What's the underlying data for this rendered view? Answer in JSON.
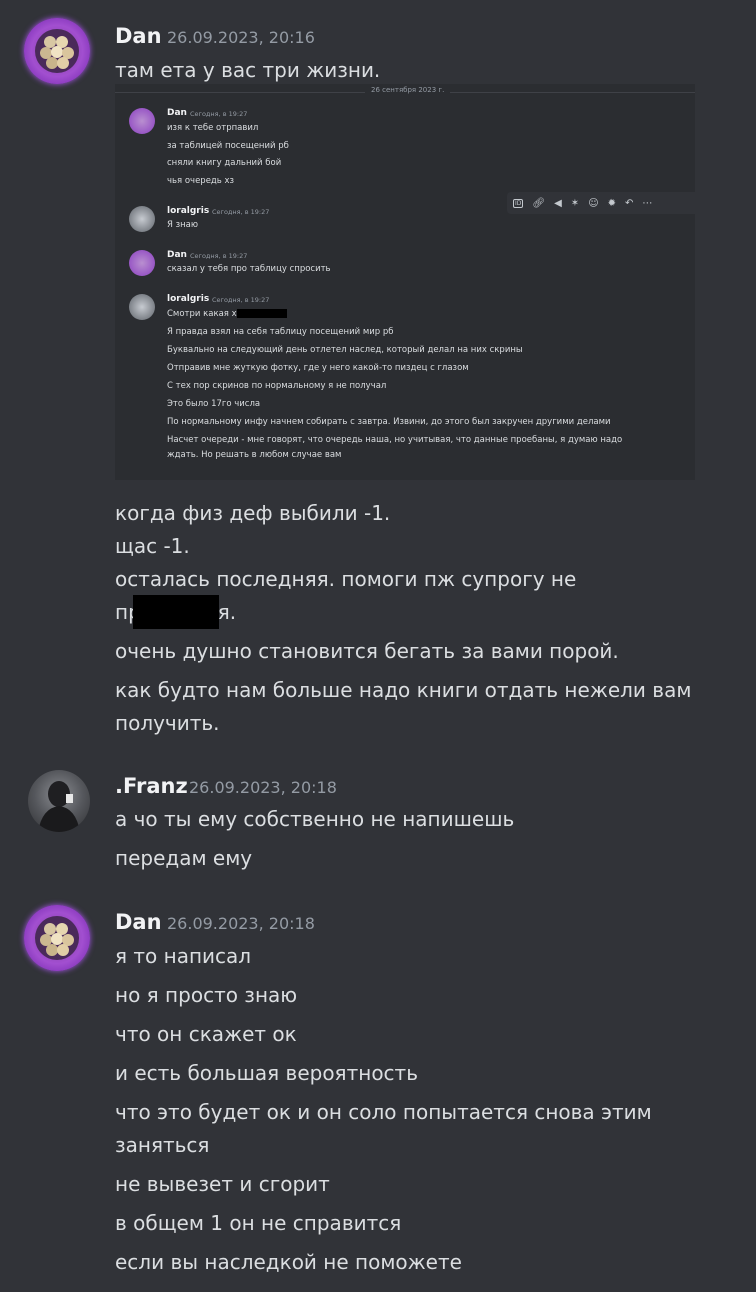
{
  "messages": [
    {
      "author": "Dan",
      "timestamp": "26.09.2023, 20:16",
      "lines_before": [
        "там ета у вас три жизни."
      ],
      "lines_after": [
        "когда физ деф выбили -1.",
        "щас -1.",
        "осталась последняя. помоги пж супрогу не",
        "пр",
        "ся.",
        "очень душно становится бегать за вами порой.",
        "как будто нам больше надо книги отдать нежели вам",
        "получить."
      ]
    },
    {
      "author": ".Franz",
      "timestamp": "26.09.2023, 20:18",
      "lines": [
        "а чо ты ему собственно не напишешь",
        "передам ему"
      ]
    },
    {
      "author": "Dan",
      "timestamp": "26.09.2023, 20:18",
      "lines": [
        "я то написал",
        "но я просто знаю",
        "что он скажет ок",
        "и есть большая вероятность",
        "что это будет ок и он соло попытается снова этим",
        "заняться",
        "не вывезет и сгорит",
        "в общем 1 он не справится",
        "если вы наследкой не поможете"
      ]
    }
  ],
  "screenshot": {
    "date_divider": "26 сентября 2023 г.",
    "blocks": [
      {
        "author": "Dan",
        "timestamp": "Сегодня, в 19:27",
        "lines": [
          "изя к тебе отрпавил",
          "за таблицей посещений рб",
          "сняли книгу дальний бой",
          "чья очередь хз"
        ]
      },
      {
        "author": "loralgris",
        "timestamp": "Сегодня, в 19:27",
        "lines": [
          "Я знаю"
        ]
      },
      {
        "author": "Dan",
        "timestamp": "Сегодня, в 19:27",
        "lines": [
          "сказал у тебя про таблицу спросить"
        ]
      },
      {
        "author": "loralgris",
        "timestamp": "Сегодня, в 19:27",
        "lines": [
          "Смотри какая х",
          "Я правда взял на себя таблицу посещений мир рб",
          "Буквально на следующий день отлетел наслед, который делал на них скрины",
          "Отправив мне жуткую фотку, где у него какой-то пиздец с глазом",
          "С тех пор скринов по нормальному я не получал",
          "Это было 17го числа",
          "По нормальному инфу начнем собирать с завтра. Извини, до этого был закручен другими делами",
          "Насчет очереди - мне говорят, что очередь наша, но учитывая, что данные проебаны, я думаю надо",
          "ждать. Но решать в любом случае вам"
        ]
      }
    ],
    "toolbar_icons": [
      "id-icon",
      "link-icon",
      "reply-icon",
      "pin-icon",
      "reaction-icon",
      "super-reaction-icon",
      "forward-icon",
      "more-icon"
    ]
  }
}
